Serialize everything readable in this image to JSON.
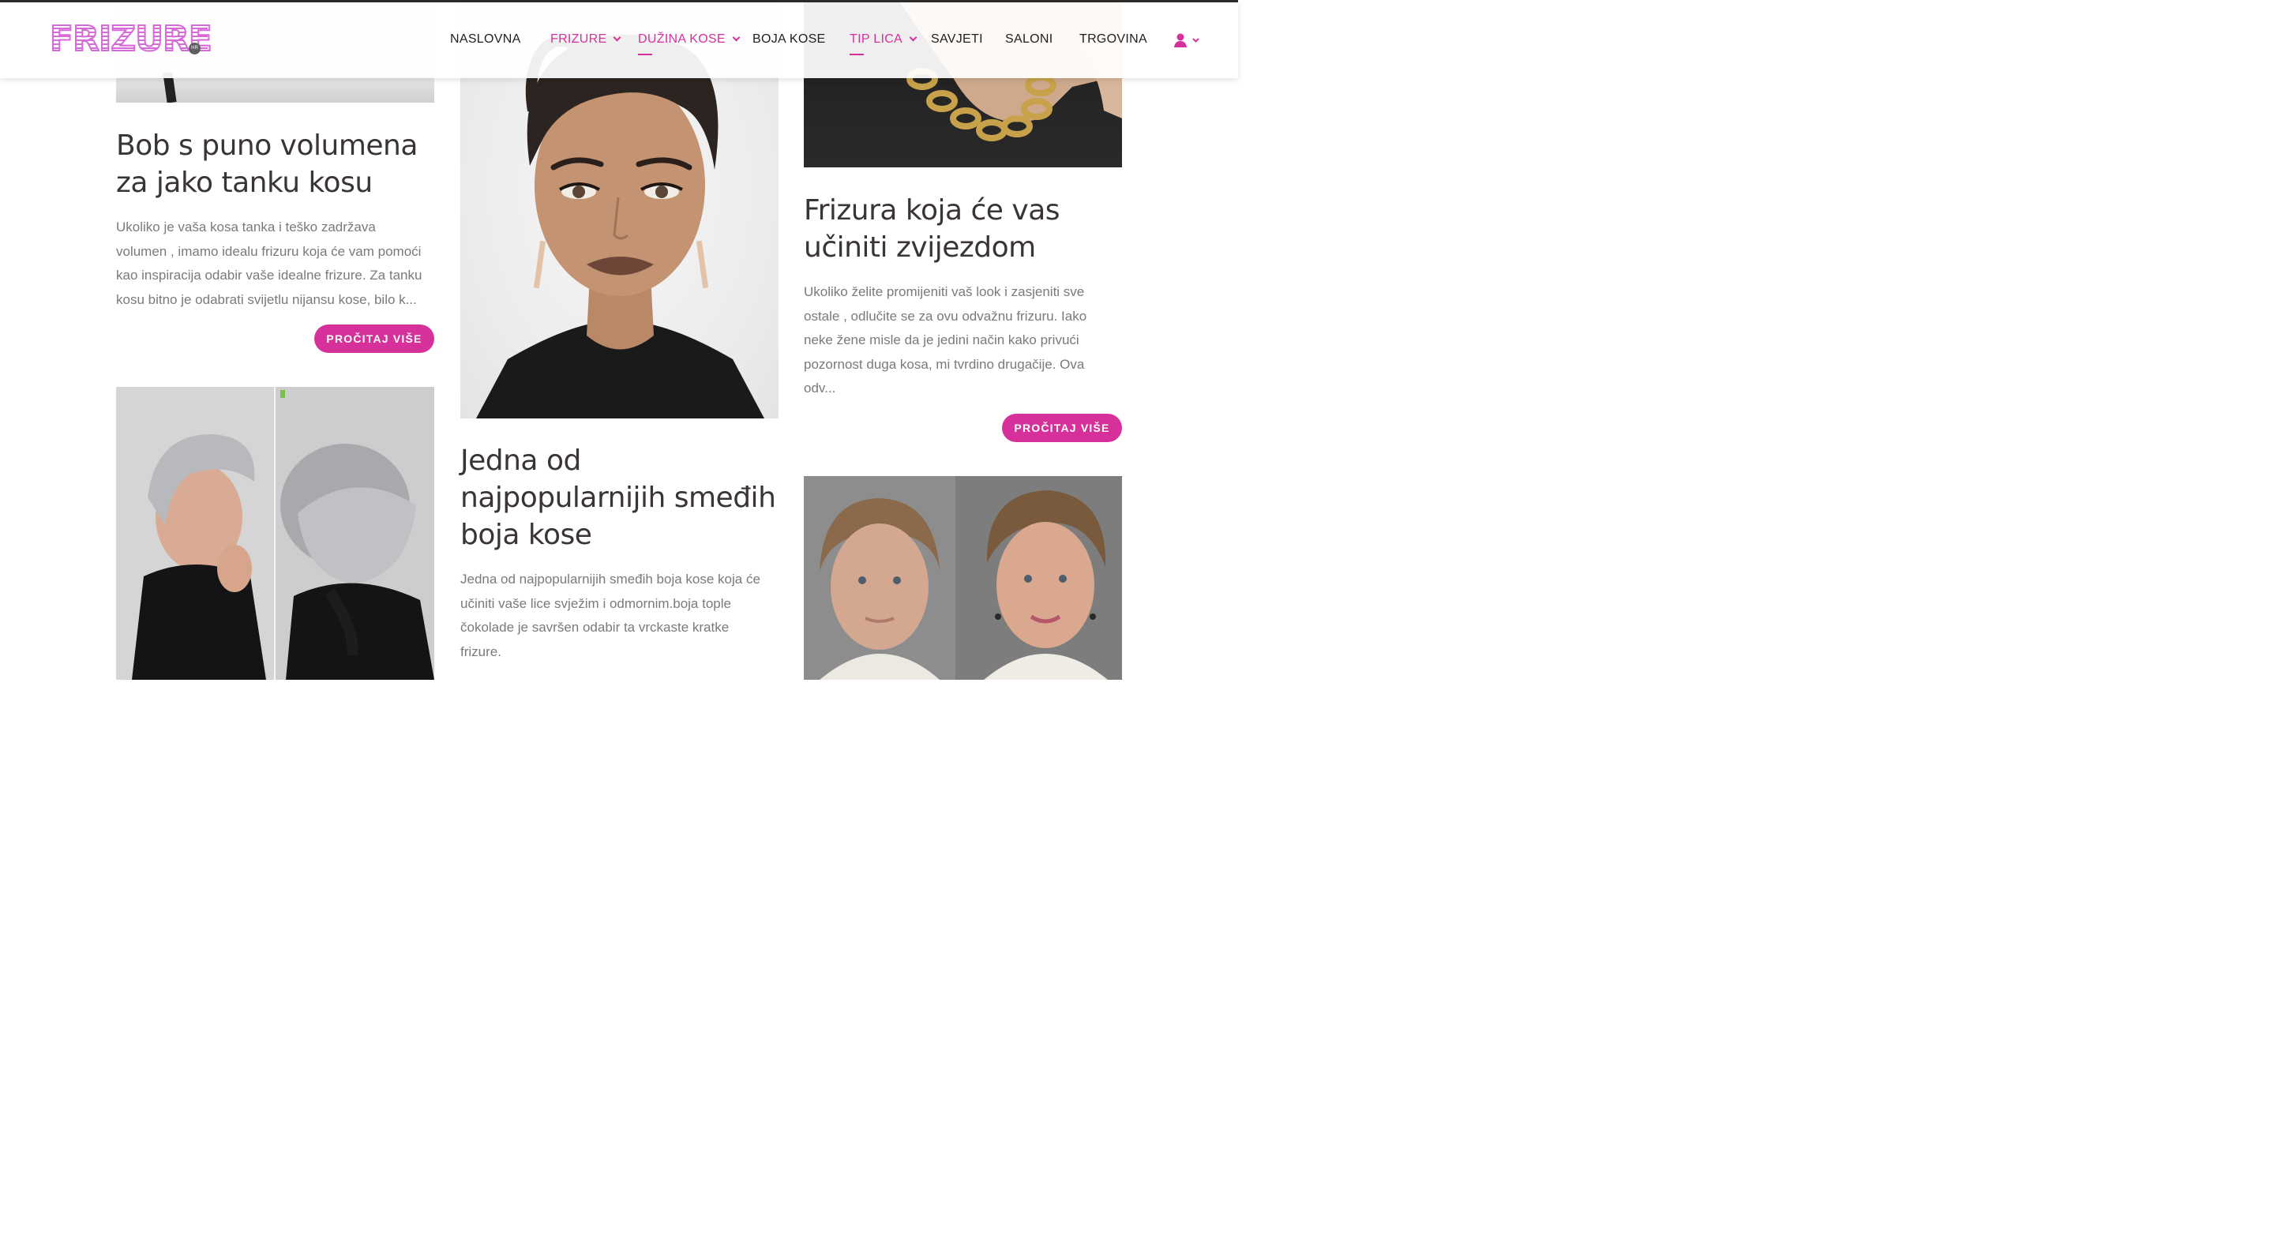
{
  "brand": {
    "logo_text": "FRIZURE",
    "logo_badge": "HR"
  },
  "nav": {
    "items": [
      {
        "label": "NASLOVNA"
      },
      {
        "label": "FRIZURE"
      },
      {
        "label": "DUŽINA KOSE"
      },
      {
        "label": "BOJA KOSE"
      },
      {
        "label": "TIP LICA"
      },
      {
        "label": "SAVJETI"
      },
      {
        "label": "SALONI"
      },
      {
        "label": "TRGOVINA"
      }
    ],
    "user_icon": "user-icon"
  },
  "colors": {
    "accent": "#d6309a",
    "logo": "#d66ad9",
    "title": "#3a3434",
    "excerpt": "#7a7a7a"
  },
  "articles": [
    {
      "title_line1": "Bob s puno volumena",
      "title_line2": "za jako tanku kosu",
      "excerpt_lines": [
        "Ukoliko je vaša kosa tanka i teško zadržava",
        "volumen , imamo idealu frizuru koja će vam pomoći",
        "kao inspiracija odabir vaše idealne frizure. Za tanku",
        "kosu bitno je odabrati svijetlu nijansu kose, bilo k..."
      ],
      "button": "PROČITAJ VIŠE"
    },
    {
      "title_line1": "Jedna od",
      "title_line2": "najpopularnijih smeđih",
      "title_line3": "boja kose",
      "excerpt_lines": [
        "Jedna od najpopularnijih smeđih boja kose koja će",
        "učiniti vaše lice svježim i odmornim.boja tople",
        "čokolade je savršen odabir ta vrckaste kratke",
        "frizure."
      ]
    },
    {
      "title_line1": "Frizura koja će vas",
      "title_line2": "učiniti zvijezdom",
      "excerpt_lines": [
        "Ukoliko želite promijeniti vaš look i zasjeniti sve",
        "ostale , odlučite se za ovu odvažnu frizuru. Iako",
        "neke žene misle da je jedini način kako privući",
        "pozornost duga kosa, mi tvrdino drugačije. Ova",
        "odv..."
      ],
      "button": "PROČITAJ VIŠE"
    }
  ]
}
